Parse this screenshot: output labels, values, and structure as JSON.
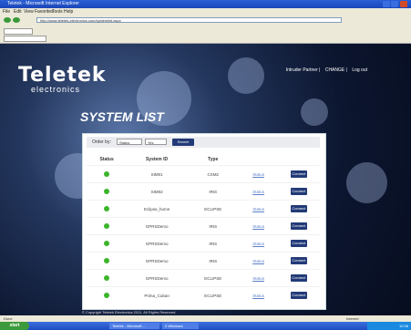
{
  "window": {
    "title": "Teletek - Microsoft Internet Explorer"
  },
  "menu": [
    "File",
    "Edit",
    "View",
    "Favorites",
    "Tools",
    "Help"
  ],
  "address": {
    "value": "http://www.teletek-electronics.com/systemlist.aspx"
  },
  "header": {
    "logo": "Teletek",
    "logo_sub": "electronics",
    "links": [
      "Intruder Partner",
      "CHANGE",
      "Log out"
    ]
  },
  "page_title": "SYSTEM LIST",
  "filter": {
    "label": "Order by:",
    "select1": "Status",
    "select2": "Yes",
    "button": "Search"
  },
  "table": {
    "headers": [
      "Status",
      "System ID",
      "Type",
      "",
      ""
    ],
    "rows": [
      {
        "id": "SIM01",
        "type": "CSM2",
        "link": "Status",
        "btn": "Connect"
      },
      {
        "id": "SIM02",
        "type": "IRIS",
        "link": "Status",
        "btn": "Connect"
      },
      {
        "id": "Eclipse_home",
        "type": "ECLIPSE",
        "link": "Status",
        "btn": "Connect"
      },
      {
        "id": "GPRSDemo",
        "type": "IRIS",
        "link": "Status",
        "btn": "Connect"
      },
      {
        "id": "GPRSDemo",
        "type": "IRIS",
        "link": "Status",
        "btn": "Connect"
      },
      {
        "id": "GPRSDemo",
        "type": "IRIS",
        "link": "Status",
        "btn": "Connect"
      },
      {
        "id": "GPRSDemo",
        "type": "ECLIPSE",
        "link": "Status",
        "btn": "Connect"
      },
      {
        "id": "Prima_Cuban",
        "type": "ECLIPSE",
        "link": "Status",
        "btn": "Connect"
      }
    ]
  },
  "footer": "© Copyright Teletek Electronics 2011. All Rights Reserved.",
  "statusbar": {
    "left": "Done",
    "right": "Internet"
  },
  "taskbar": {
    "start": "start",
    "tasks": [
      "Teletek - Microsoft...",
      "2 Windows"
    ],
    "clock": "10:38"
  }
}
